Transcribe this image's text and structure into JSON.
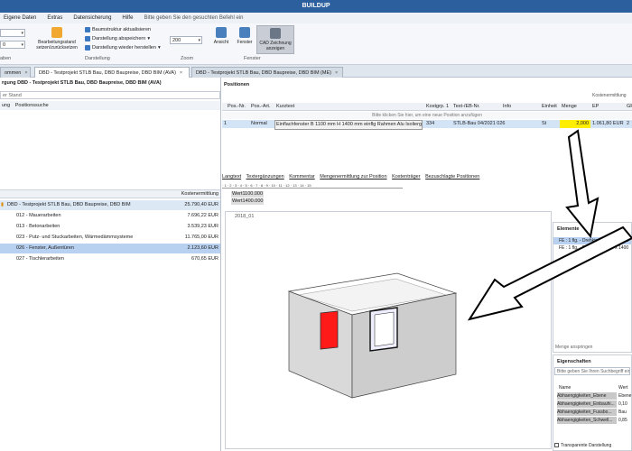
{
  "window": {
    "title": "BUILDUP"
  },
  "menu": {
    "items": [
      "Eigene Daten",
      "Extras",
      "Datensicherung",
      "Hilfe"
    ],
    "hint": "Bitte geben Sie den gesuchten Befehl ein"
  },
  "ribbon": {
    "btn_bearbeitungsstand": "Bearbeitungsstand setzen/zurücksetzen",
    "btn_baumstruktur": "Baumstruktur aktualisieren",
    "btn_darstellung_speichern": "Darstellung abspeichern",
    "btn_darstellung_wieder": "Darstellung wieder herstellen",
    "group_darstellung": "Darstellung",
    "zoom_value": "200",
    "group_zoom": "Zoom",
    "btn_ansicht": "Ansicht",
    "btn_fenster": "Fenster",
    "btn_cad": "CAD Zeichnung anzeigen",
    "group_fenster": "Fenster",
    "group_left_label": "aben",
    "combo_left_value": "0"
  },
  "tabs": [
    {
      "label": "ommen",
      "closable": true,
      "active": false
    },
    {
      "label": "DBD - Testprojekt STLB Bau, DBD Baupreise, DBD BIM (AVA)",
      "closable": true,
      "active": true
    },
    {
      "label": "DBD - Testprojekt STLB Bau, DBD Baupreise, DBD BIM (ME)",
      "closable": true,
      "active": false
    }
  ],
  "left": {
    "header": "rgung DBD - Testprojekt STLB Bau, DBD Baupreise, DBD BIM (AVA)",
    "filter_text": "er Stand",
    "subtabs": [
      "ung",
      "Positionssuche"
    ],
    "col_cost": "Kostenermittlung",
    "tree": [
      {
        "label": "DBD - Testprojekt STLB Bau, DBD Baupreise, DBD BIM",
        "value": "25.790,40 EUR",
        "type": "root"
      },
      {
        "label": "012 - Mauerarbeiten",
        "value": "7.696,22 EUR",
        "type": "child"
      },
      {
        "label": "013 - Betonarbeiten",
        "value": "3.539,23 EUR",
        "type": "child"
      },
      {
        "label": "023 - Putz- und Stuckarbeiten, Wärmedämmsysteme",
        "value": "11.765,00 EUR",
        "type": "child"
      },
      {
        "label": "026 - Fenster, Außentüren",
        "value": "2.123,60 EUR",
        "type": "sel"
      },
      {
        "label": "027 - Tischlerarbeiten",
        "value": "670,65 EUR",
        "type": "child"
      }
    ]
  },
  "positions": {
    "title": "Positionen",
    "col_kostenermittlung": "Kostenermittlung",
    "columns": [
      "Pos.-Nr.",
      "Pos.-Art.",
      "Kurztext",
      "Kostgrp. 1",
      "Text-/EB-Nr.",
      "Info",
      "Einheit",
      "Menge",
      "EP",
      "GP"
    ],
    "hint": "Bitte klicken Sie hier, um eine neue Position anzufügen",
    "row": {
      "nr": "1",
      "art": "Normal",
      "kurztext": "Einflachfenster B 1100 mm H 1400 mm einflg Rahmen Alu Isolierglas 3fach",
      "kostgrp": "334",
      "text_nr": "STLB-Bau 04/2021 026",
      "einheit": "St",
      "menge": "2,000",
      "ep": "1.061,80 EUR",
      "gp": "2"
    }
  },
  "detail_tabs": [
    "Langtext",
    "Textergänzungen",
    "Kommentar",
    "Mengenermittlung zur Position",
    "Kostenträger",
    "Bezuschlagte Positionen"
  ],
  "ruler_text": "· 1 · 2 · 3 · 4 · 5 · 6 · 7 · 8 · 9 · 10 · 11 · 12 · 13 · 14 · 15",
  "wert_lines": [
    "Wert1100.000",
    "Wert1400.000"
  ],
  "view_label": "2018_01",
  "elemente": {
    "title": "Elemente",
    "items": [
      "FE : 1 flg. - Drehkipp : 1100 x 1400",
      "FE : 1 flg. - Drehkipp : 1100 x 1400"
    ],
    "jump": "Menge anspringen"
  },
  "eigenschaften": {
    "title": "Eigenschaften",
    "search": "Bitte geben Sie Ihren Suchbegriff ein",
    "col_name": "Name",
    "col_wert": "Wert",
    "rows": [
      {
        "name": "Abhaengigkeiten_Ebene",
        "value": "Ebene"
      },
      {
        "name": "Abhaengigkeiten_Einbauhi...",
        "value": "0,10"
      },
      {
        "name": "Abhaengigkeiten_Fussbo...",
        "value": "Bau"
      },
      {
        "name": "Abhaengigkeiten_Schwell...",
        "value": "0,85"
      }
    ],
    "footer": "Transparente Darstellung"
  },
  "colors": {
    "title": "#2b5f9e",
    "selection": "#b8d1f0",
    "row_highlight": "#d4e4f7",
    "menge_highlight": "#ffee00",
    "window_red": "#ff1a1a"
  }
}
